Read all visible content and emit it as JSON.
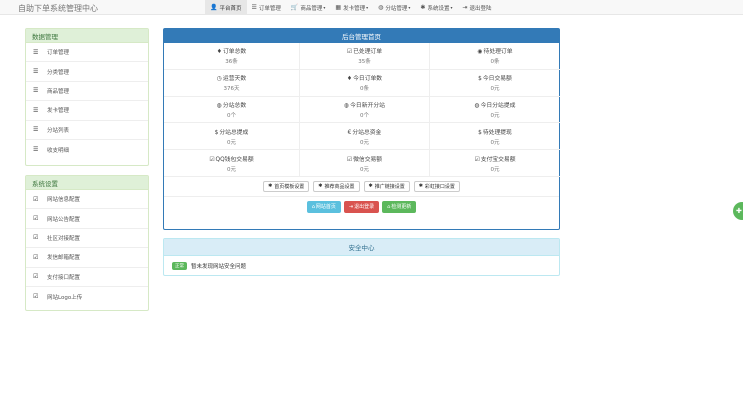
{
  "brand": "自助下单系统管理中心",
  "nav": [
    {
      "label": "平台首页",
      "icon": "user-icon",
      "glyph": "👤",
      "active": true
    },
    {
      "label": "订单管理",
      "icon": "list-icon",
      "glyph": "☰"
    },
    {
      "label": "商品管理",
      "icon": "cart-icon",
      "glyph": "🛒",
      "dropdown": true
    },
    {
      "label": "发卡管理",
      "icon": "table-icon",
      "glyph": "▦",
      "dropdown": true
    },
    {
      "label": "分站管理",
      "icon": "globe-icon",
      "glyph": "◍",
      "dropdown": true
    },
    {
      "label": "系统设置",
      "icon": "gear-icon",
      "glyph": "✱",
      "dropdown": true
    },
    {
      "label": "退出登陆",
      "icon": "logout-icon",
      "glyph": "⇥"
    }
  ],
  "sidebar": {
    "data_title": "数据管理",
    "data_items": [
      "订单管理",
      "分类管理",
      "商品管理",
      "发卡管理",
      "分站列表",
      "收支明细"
    ],
    "system_title": "系统设置",
    "system_items": [
      "网站信息配置",
      "网站公告配置",
      "社区对接配置",
      "发信邮箱配置",
      "支付接口配置",
      "网站Logo上传"
    ]
  },
  "main": {
    "title": "后台管理首页",
    "stats": [
      {
        "label": "订单总数",
        "value": "36条",
        "glyph": "♦"
      },
      {
        "label": "已处理订单",
        "value": "35条",
        "glyph": "☑"
      },
      {
        "label": "待处理订单",
        "value": "0条",
        "glyph": "◉"
      },
      {
        "label": "运营天数",
        "value": "376天",
        "glyph": "◷"
      },
      {
        "label": "今日订单数",
        "value": "0条",
        "glyph": "♦"
      },
      {
        "label": "今日交易额",
        "value": "0元",
        "glyph": "$"
      },
      {
        "label": "分站总数",
        "value": "0个",
        "glyph": "◍"
      },
      {
        "label": "今日新开分站",
        "value": "0个",
        "glyph": "◍"
      },
      {
        "label": "今日分站提成",
        "value": "0元",
        "glyph": "◍"
      },
      {
        "label": "分站总提成",
        "value": "0元",
        "glyph": "$"
      },
      {
        "label": "分站总资金",
        "value": "0元",
        "glyph": "€"
      },
      {
        "label": "待处理提现",
        "value": "0元",
        "glyph": "$"
      },
      {
        "label": "QQ钱包交易额",
        "value": "0元",
        "glyph": "☑"
      },
      {
        "label": "微信交易额",
        "value": "0元",
        "glyph": "☑"
      },
      {
        "label": "支付宝交易额",
        "value": "0元",
        "glyph": "☑"
      }
    ],
    "config_buttons": [
      "首页模板设置",
      "推荐商品设置",
      "推广链接设置",
      "彩虹接口设置"
    ],
    "actions": {
      "home": "网站首页",
      "logout": "退出登录",
      "update": "检测更新"
    }
  },
  "security": {
    "title": "安全中心",
    "badge": "正常",
    "message": "暂未发现网站安全问题"
  },
  "colors": {
    "primary": "#337ab7",
    "success": "#5cb85c",
    "danger": "#d9534f",
    "info": "#5bc0de"
  }
}
